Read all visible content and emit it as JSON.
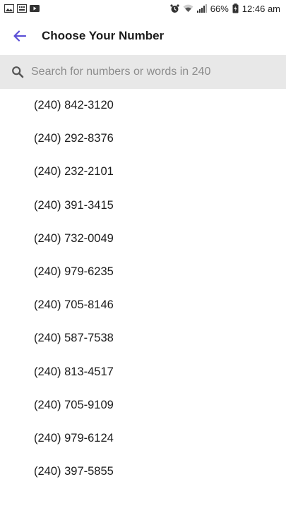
{
  "status_bar": {
    "battery": "66%",
    "time": "12:46 am"
  },
  "app_bar": {
    "title": "Choose Your Number",
    "back_icon": "arrow-left-icon",
    "accent": "#5b4fd6"
  },
  "search": {
    "placeholder": "Search for numbers or words in 240",
    "value": ""
  },
  "numbers": [
    "(240) 842-3120",
    "(240) 292-8376",
    "(240) 232-2101",
    "(240) 391-3415",
    "(240) 732-0049",
    "(240) 979-6235",
    "(240) 705-8146",
    "(240) 587-7538",
    "(240) 813-4517",
    "(240) 705-9109",
    "(240) 979-6124",
    "(240) 397-5855"
  ]
}
